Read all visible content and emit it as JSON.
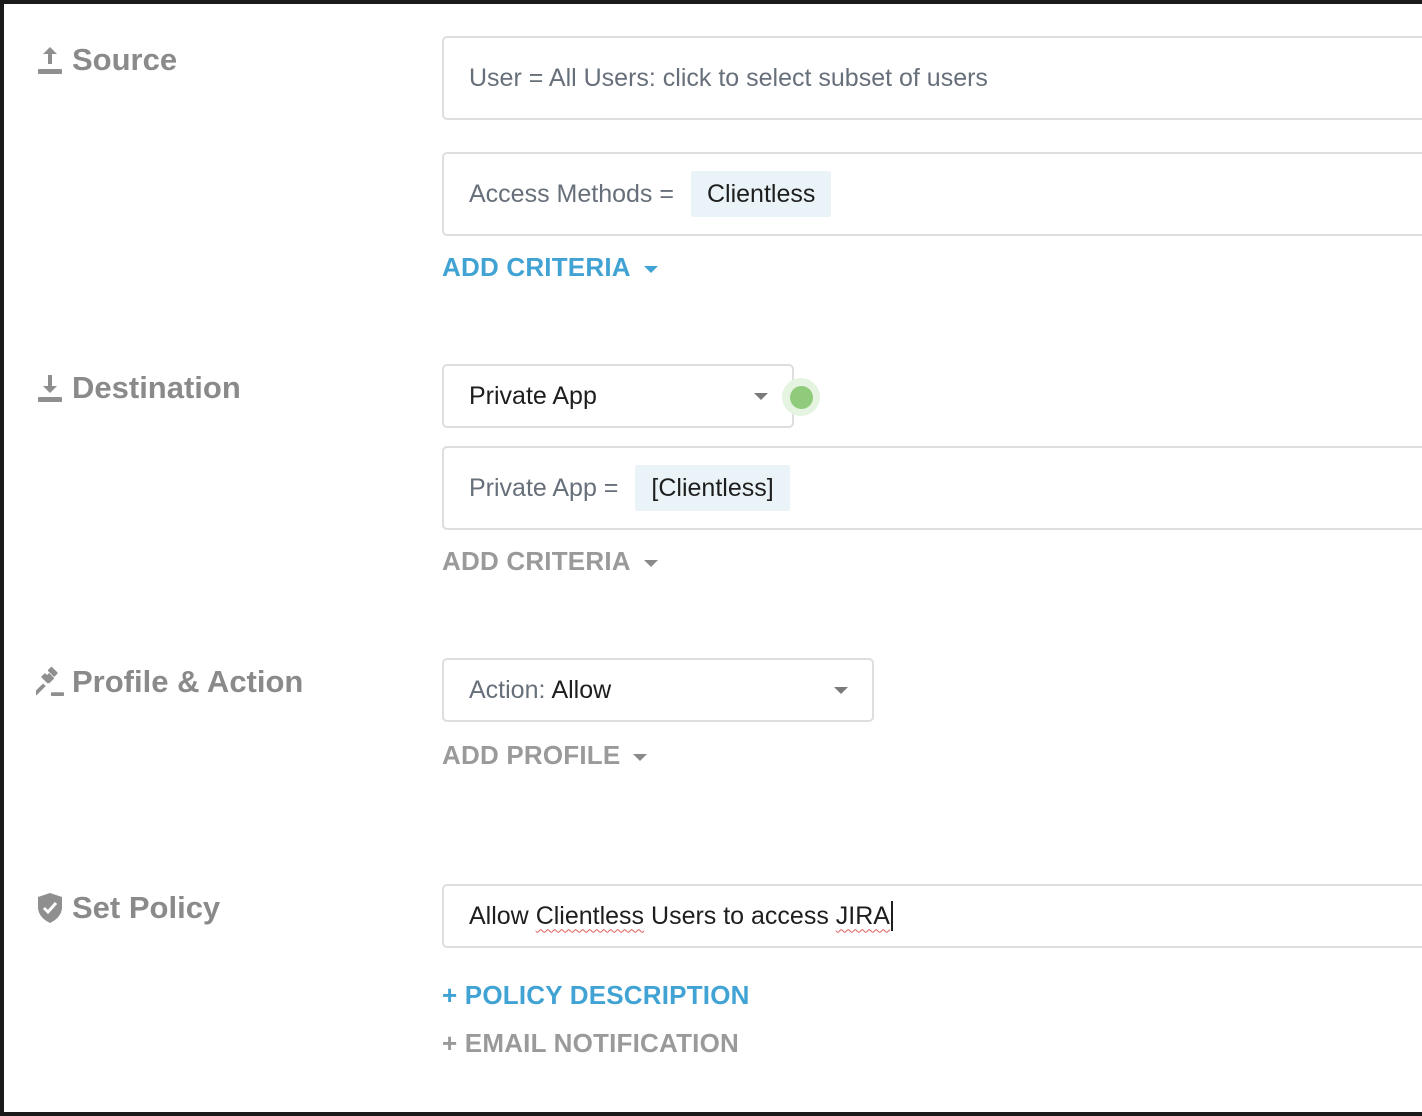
{
  "source": {
    "label": "Source",
    "icon": "upload-icon",
    "user_field": "User = All Users: click to select subset of users",
    "access_methods": {
      "label": "Access Methods =",
      "value": "Clientless"
    },
    "add_criteria": "ADD CRITERIA"
  },
  "destination": {
    "label": "Destination",
    "icon": "download-icon",
    "type_select": "Private App",
    "status_color": "#8fcb7a",
    "private_app": {
      "label": "Private App =",
      "value": "[Clientless]"
    },
    "add_criteria": "ADD CRITERIA"
  },
  "profile_action": {
    "label": "Profile & Action",
    "icon": "gavel-icon",
    "action_label": "Action:",
    "action_value": "Allow",
    "add_profile": "ADD PROFILE"
  },
  "set_policy": {
    "label": "Set Policy",
    "icon": "shield-check-icon",
    "name_parts": [
      "Allow ",
      "Clientless",
      " Users to access ",
      "JIRA"
    ],
    "policy_description": "+ POLICY DESCRIPTION",
    "email_notification": "+ EMAIL NOTIFICATION"
  },
  "colors": {
    "link_blue": "#41a3d3",
    "link_gray": "#9a9a9a",
    "label_gray": "#8a8a8a"
  }
}
